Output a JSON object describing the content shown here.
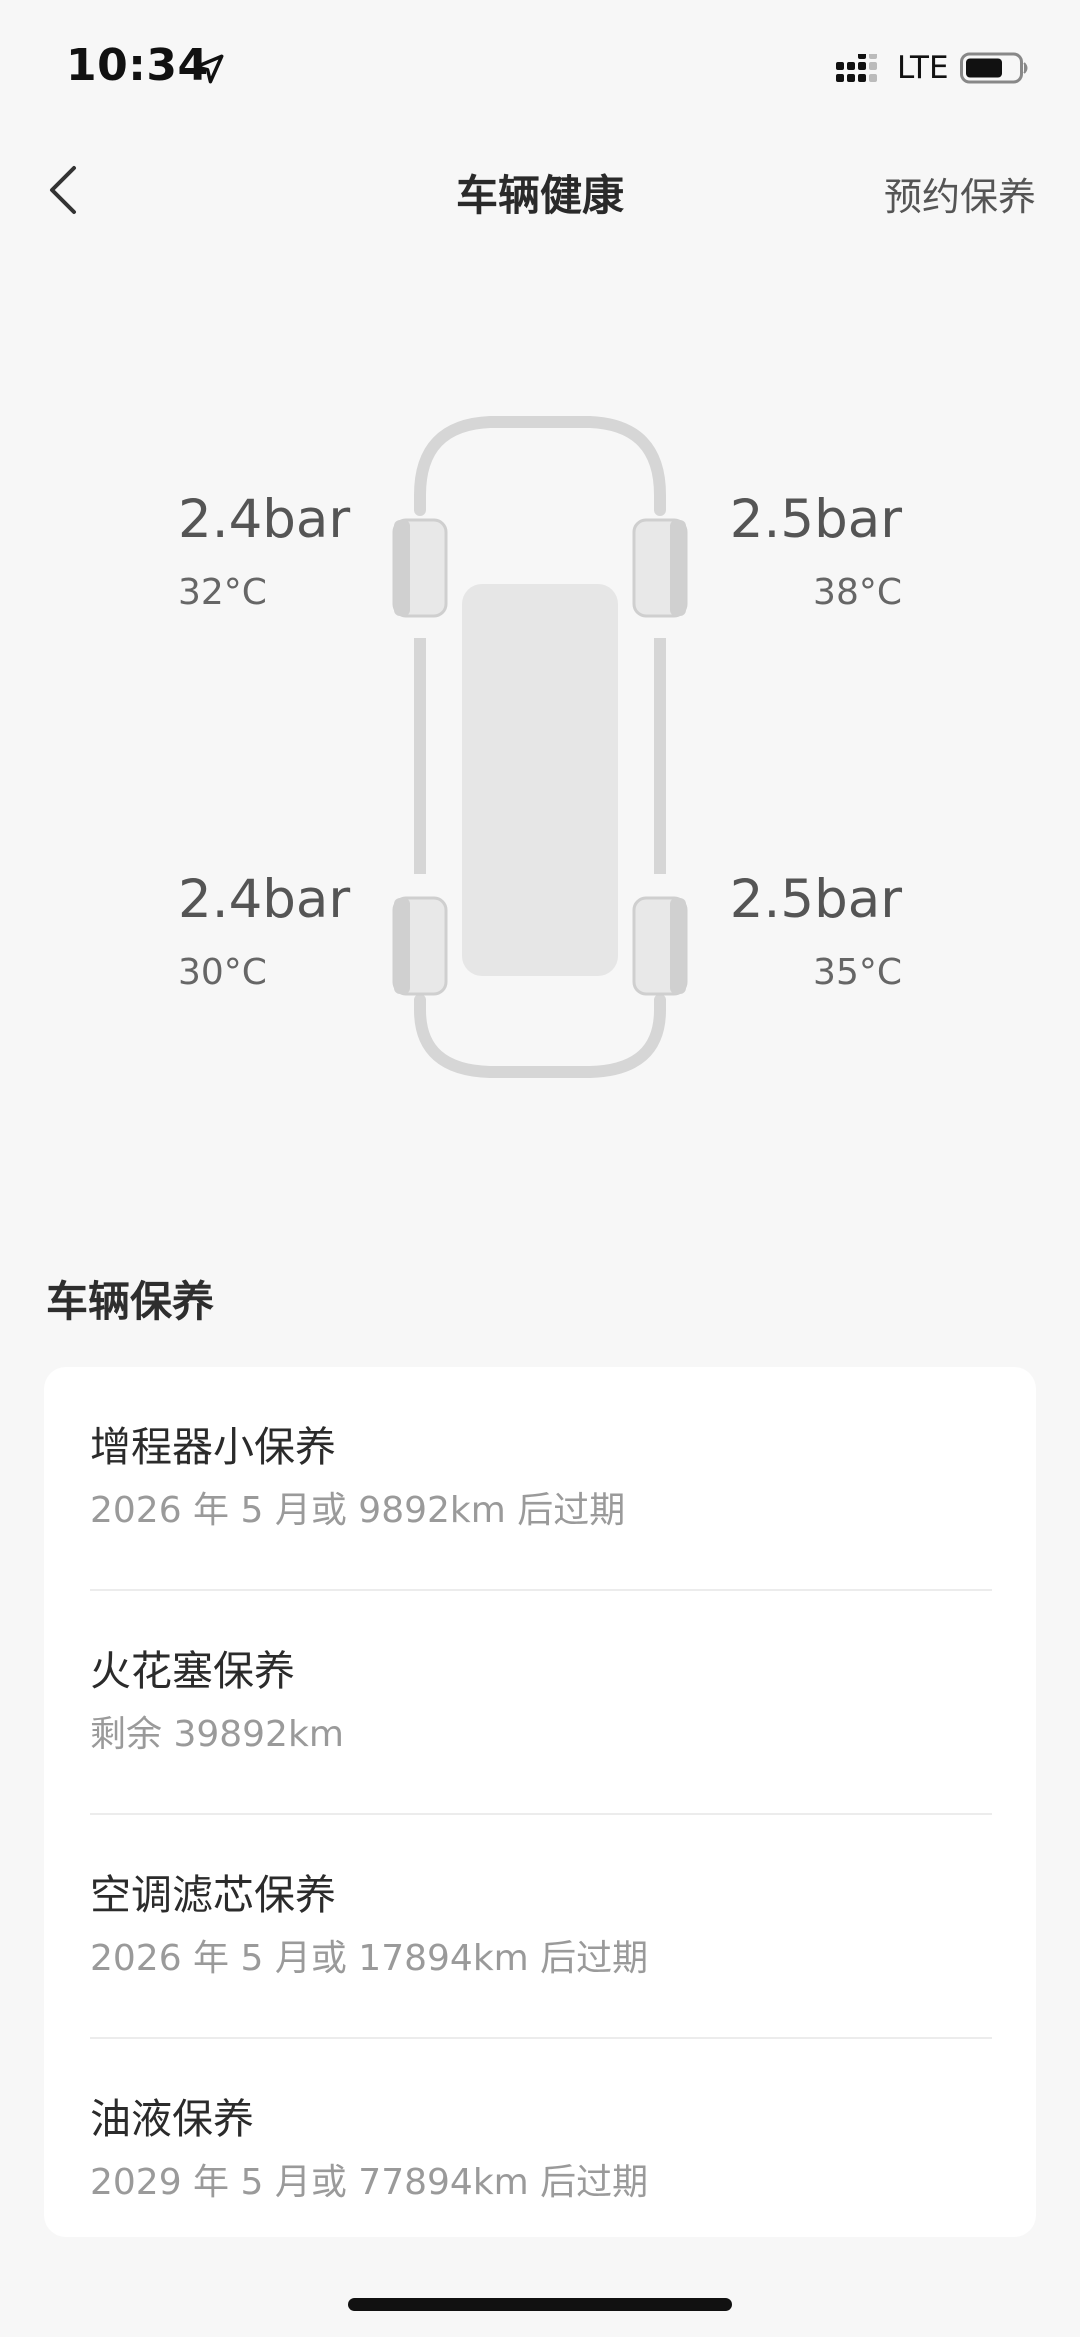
{
  "status_bar": {
    "time": "10:34",
    "network": "LTE",
    "icons": [
      "location-arrow-icon",
      "signal-icon",
      "battery-icon"
    ]
  },
  "nav": {
    "title": "车辆健康",
    "action": "预约保养",
    "back_icon": "chevron-left-icon"
  },
  "tires": {
    "front_left": {
      "pressure": "2.4bar",
      "temp": "32°C"
    },
    "front_right": {
      "pressure": "2.5bar",
      "temp": "38°C"
    },
    "rear_left": {
      "pressure": "2.4bar",
      "temp": "30°C"
    },
    "rear_right": {
      "pressure": "2.5bar",
      "temp": "35°C"
    }
  },
  "maintenance": {
    "title": "车辆保养",
    "items": [
      {
        "name": "增程器小保养",
        "detail": "2026 年 5 月或 9892km 后过期"
      },
      {
        "name": "火花塞保养",
        "detail": "剩余 39892km"
      },
      {
        "name": "空调滤芯保养",
        "detail": "2026 年 5 月或 17894km 后过期"
      },
      {
        "name": "油液保养",
        "detail": "2029 年 5 月或 77894km 后过期"
      }
    ]
  },
  "colors": {
    "background": "#f7f7f7",
    "card": "#ffffff",
    "car_outline": "#d6d6d6",
    "car_body": "#e6e6e6"
  }
}
